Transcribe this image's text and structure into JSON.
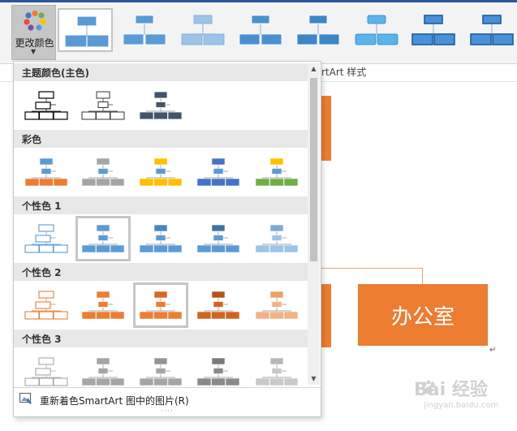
{
  "ribbon": {
    "change_color_label": "更改颜色",
    "gallery_caption": "rtArt 样式",
    "style_thumbs": [
      {
        "kind": "flat",
        "fill": "#5b9bd5",
        "stroke": "#5b9bd5",
        "selected": true
      },
      {
        "kind": "flat",
        "fill": "#5b9bd5",
        "stroke": "#ffffff"
      },
      {
        "kind": "flat",
        "fill": "#9dc3e6",
        "stroke": "#7aaad6"
      },
      {
        "kind": "flat",
        "fill": "#4a8fd0",
        "stroke": "#ffffff"
      },
      {
        "kind": "flat",
        "fill": "#3d85c6",
        "stroke": "#ffffff"
      },
      {
        "kind": "bevel",
        "fill": "#5ab4ea",
        "stroke": "#2e86c1"
      },
      {
        "kind": "framed",
        "fill": "#4a90d9",
        "stroke": "#1f5e9e"
      },
      {
        "kind": "framed",
        "fill": "#4a90d9",
        "stroke": "#1f5e9e"
      }
    ]
  },
  "menu": {
    "sections": [
      {
        "title": "主题颜色(主色)",
        "rows": [
          {
            "fill": "#ffffff",
            "stroke": "#000000",
            "bw": 1.2,
            "style": "outline-cascade"
          },
          {
            "fill": "#ffffff",
            "stroke": "#333333",
            "bw": 1,
            "style": "outline"
          },
          {
            "fill": "#44546a",
            "stroke": "#ffffff",
            "bw": 0.8,
            "style": "solid"
          }
        ]
      },
      {
        "title": "彩色",
        "rows": [
          {
            "top": "#5b9bd5",
            "bottom": "#ed7d31",
            "stroke": "#ffffff",
            "bw": 0.6,
            "style": "two-tone"
          },
          {
            "top": "#a5a5a5",
            "bottom": "#a5a5a5",
            "stroke": "#ffffff",
            "bw": 0.6,
            "style": "two-tone",
            "accent": "#5b9bd5"
          },
          {
            "top": "#ffc000",
            "bottom": "#ffc000",
            "stroke": "#ffffff",
            "bw": 0.6,
            "style": "two-tone",
            "accent": "#5b9bd5"
          },
          {
            "top": "#4472c4",
            "bottom": "#4472c4",
            "stroke": "#ffffff",
            "bw": 0.6,
            "style": "two-tone",
            "accent": "#5b9bd5"
          },
          {
            "top": "#ffc000",
            "bottom": "#70ad47",
            "stroke": "#ffffff",
            "bw": 0.6,
            "style": "two-tone",
            "accent": "#5b9bd5"
          }
        ]
      },
      {
        "title": "个性色 1",
        "rows": [
          {
            "fill": "#ffffff",
            "stroke": "#5b9bd5",
            "bw": 1.1,
            "style": "outline-cascade"
          },
          {
            "fill": "#5b9bd5",
            "stroke": "#ffffff",
            "bw": 0.6,
            "style": "solid",
            "selected": true
          },
          {
            "fill": "#5b9bd5",
            "stroke": "#ffffff",
            "bw": 0.6,
            "style": "solid",
            "topfill": "#4a86c0"
          },
          {
            "fill": "#5b9bd5",
            "stroke": "#ffffff",
            "bw": 0.6,
            "style": "solid",
            "topfill": "#3f72a6"
          },
          {
            "fill": "#9dc3e6",
            "stroke": "#ffffff",
            "bw": 0.6,
            "style": "solid",
            "topfill": "#7aaad6"
          }
        ]
      },
      {
        "title": "个性色 2",
        "rows": [
          {
            "fill": "#ffffff",
            "stroke": "#ed7d31",
            "bw": 1.1,
            "style": "outline-cascade"
          },
          {
            "fill": "#ed7d31",
            "stroke": "#ffffff",
            "bw": 0.6,
            "style": "solid"
          },
          {
            "fill": "#ed7d31",
            "stroke": "#ffffff",
            "bw": 0.6,
            "style": "solid",
            "selected": true,
            "topfill": "#d8672a"
          },
          {
            "fill": "#d06522",
            "stroke": "#ffffff",
            "bw": 0.6,
            "style": "solid",
            "topfill": "#b2541b"
          },
          {
            "fill": "#f4b183",
            "stroke": "#ffffff",
            "bw": 0.6,
            "style": "solid",
            "topfill": "#f09f66"
          }
        ]
      },
      {
        "title": "个性色 3",
        "rows": [
          {
            "fill": "#ffffff",
            "stroke": "#a5a5a5",
            "bw": 1.1,
            "style": "outline-cascade"
          },
          {
            "fill": "#a5a5a5",
            "stroke": "#ffffff",
            "bw": 0.6,
            "style": "solid"
          },
          {
            "fill": "#a5a5a5",
            "stroke": "#ffffff",
            "bw": 0.6,
            "style": "solid",
            "topfill": "#949494"
          },
          {
            "fill": "#8a8a8a",
            "stroke": "#ffffff",
            "bw": 0.6,
            "style": "solid",
            "topfill": "#7a7a7a"
          },
          {
            "fill": "#c9c9c9",
            "stroke": "#ffffff",
            "bw": 0.6,
            "style": "solid",
            "topfill": "#b8b8b8"
          }
        ]
      }
    ],
    "recolor_label": "重新着色SmartArt 图中的图片(R)",
    "grip": "····"
  },
  "slide": {
    "office_box_text": "办公室"
  },
  "watermark": {
    "big": "Bai 经验",
    "small": "jingyan.baidu.com"
  },
  "colors": {
    "accent_orange": "#ed7d31",
    "accent_blue": "#5b9bd5",
    "ribbon_blue": "#2b579a"
  }
}
